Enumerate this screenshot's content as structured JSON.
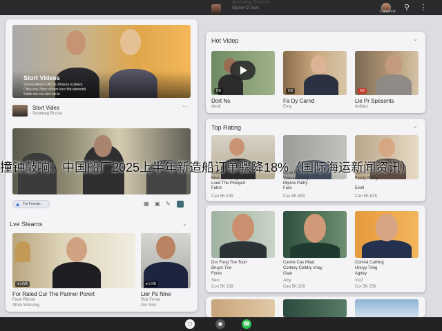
{
  "header": {
    "channel_line1": "Apsssing Srssme",
    "channel_line2": "Sprsrir Ct Sors",
    "user_name": "Cotteriond",
    "icons": {
      "avatar": "user-avatar",
      "search": "search-icon",
      "more": "more-vertical-icon"
    }
  },
  "hero": {
    "title": "Stort Videos",
    "line1": "Sronscutfeocs sfficce ofhsiors ncliwers",
    "line2": "Clflou ros Zlhoc eSmm loco fhb sfarmmtl.",
    "line3": "Soblc cro coc Isot nol.ln",
    "card_title": "Stort Vides",
    "card_sub": "Sooneeg Ri ose",
    "more_label": "⋯"
  },
  "second_card": {
    "chip_label": "Tre Froertic",
    "tool_icons": [
      "grid-icon",
      "image-icon",
      "edit-icon",
      "share-icon"
    ]
  },
  "live_streams": {
    "title": "Lve Steams",
    "items": [
      {
        "title": "For Rated Cur The Parmer Porert",
        "sub1": "Fook  Rforse",
        "sub2": "Sfoto Mrstetng"
      },
      {
        "title": "Lier Ps Nine",
        "sub1": "Ros Frnse",
        "sub2": "Dsi Sosr"
      }
    ]
  },
  "hot_videos": {
    "title": "Hot Videp",
    "items": [
      {
        "title": "Dort Ns",
        "sub": "Anoll"
      },
      {
        "title": "Fa Dy Carnd",
        "sub": "Enry"
      },
      {
        "title": "Lle Pr Spesonts",
        "sub": "Avlliars"
      }
    ]
  },
  "top_rating": {
    "title": "Top Rating",
    "items": [
      {
        "title": "Ltrlas Ting Ufing",
        "line2": "Enrc Sse Tnrg",
        "line3": "Loed The Ploogert",
        "line4": "Fahrs",
        "meta": "Can 5K £39"
      },
      {
        "title": "Oyoo Fuot Mpme",
        "line2": "Vsevar Gratry",
        "line3": "Miproe Paltry",
        "line4": "Fura",
        "meta": "Cas 5K £89"
      },
      {
        "title": "Sonrs Raaigs",
        "line2": "Fianty Ralny",
        "line3": "Exoll",
        "line4": "",
        "meta": "Can 5K £29"
      }
    ]
  },
  "creators": {
    "items": [
      {
        "title": "Dor Fong The Toorr",
        "line2": "Bruyrs Tne",
        "line3": "Fores",
        "meta1": "Serc",
        "meta2": "Con 5K 239"
      },
      {
        "title": "Carme Cas Mlad",
        "line2": "Corteey Celldry Vnay",
        "line3": "Oaar",
        "meta1": "Aloy",
        "meta2": "Can 5K 209"
      },
      {
        "title": "Comral Cathing",
        "line2": "Ursryy Tring",
        "line3": "Aglrey",
        "meta1": "Vscf",
        "meta2": "Cor 5K 259"
      }
    ]
  },
  "overlay_banner": "撞钟敲响：中国船厂2025上半年新造船订单骤降18%（国际海运新闻资讯）",
  "colors": {
    "topbar": "#2b2b2e",
    "panel": "#f4f4f6",
    "background": "#dcdde0",
    "accent_badge": "#c0392b"
  }
}
